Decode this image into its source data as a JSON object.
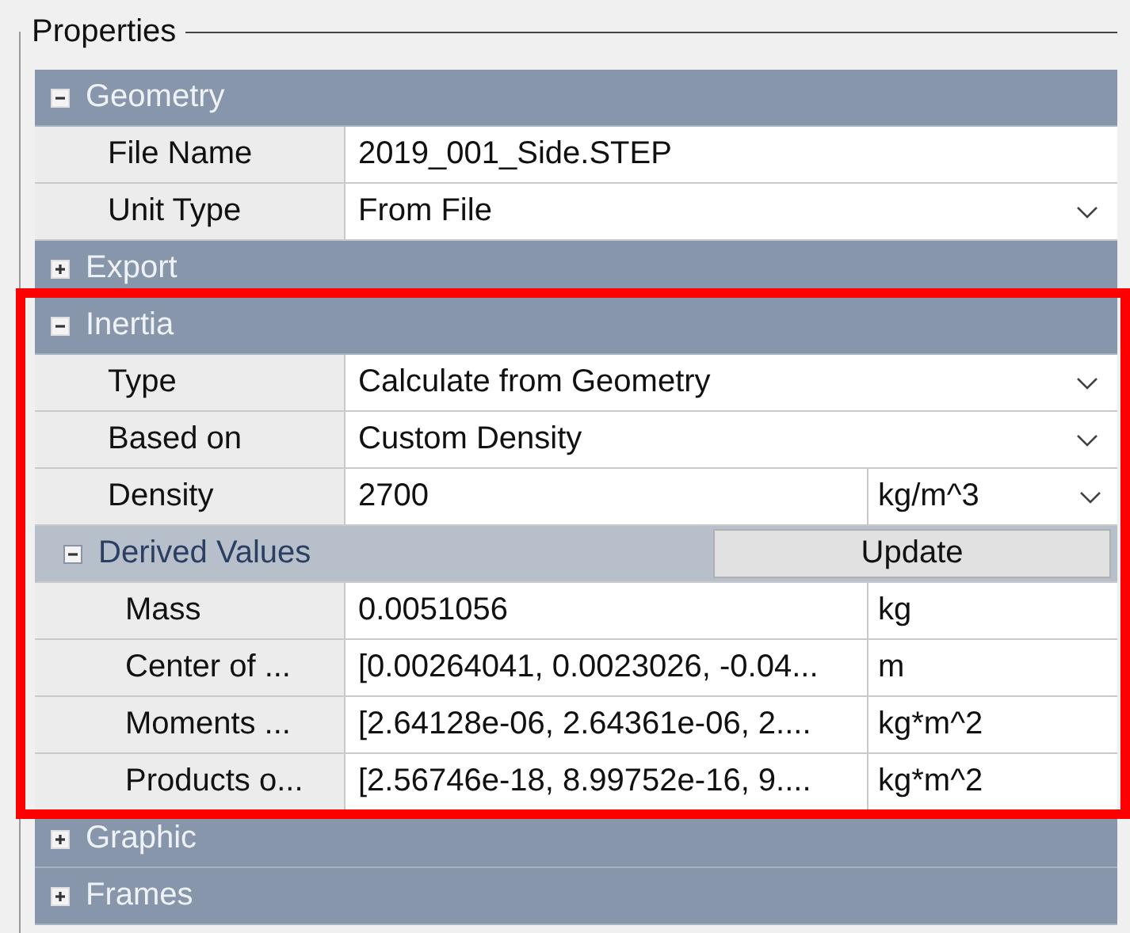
{
  "groupbox": {
    "title": "Properties"
  },
  "categories": [
    {
      "name": "Geometry",
      "expanded": true,
      "rows": [
        {
          "label": "File Name",
          "value": "2019_001_Side.STEP"
        },
        {
          "label": "Unit Type",
          "value": "From File",
          "dropdown": true
        }
      ]
    },
    {
      "name": "Export",
      "expanded": false
    },
    {
      "name": "Inertia",
      "expanded": true,
      "highlighted": true,
      "rows": [
        {
          "label": "Type",
          "value": "Calculate from Geometry",
          "dropdown": true
        },
        {
          "label": "Based on",
          "value": "Custom Density",
          "dropdown": true
        },
        {
          "label": "Density",
          "value": "2700",
          "unit": "kg/m^3",
          "dropdown": true
        }
      ],
      "subcategories": [
        {
          "name": "Derived Values",
          "expanded": true,
          "button": "Update",
          "rows": [
            {
              "label": "Mass",
              "value": "0.0051056",
              "unit": "kg"
            },
            {
              "label": "Center of ...",
              "value": "[0.00264041, 0.0023026, -0.04...",
              "unit": "m"
            },
            {
              "label": "Moments ...",
              "value": "[2.64128e-06, 2.64361e-06, 2....",
              "unit": "kg*m^2"
            },
            {
              "label": "Products o...",
              "value": "[2.56746e-18, 8.99752e-16, 9....",
              "unit": "kg*m^2"
            }
          ]
        }
      ]
    },
    {
      "name": "Graphic",
      "expanded": false
    },
    {
      "name": "Frames",
      "expanded": false
    }
  ]
}
